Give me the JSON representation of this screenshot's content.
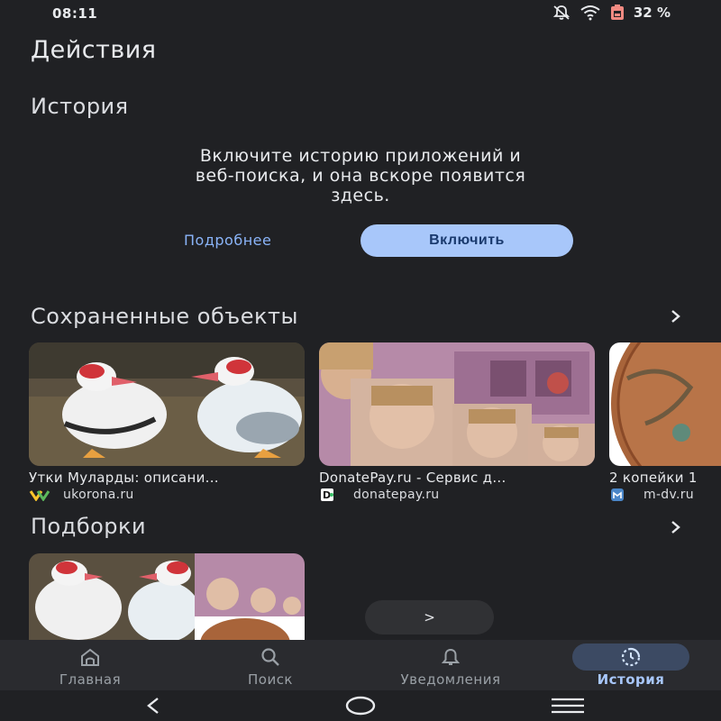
{
  "status": {
    "time": "08:11",
    "battery": "32 %"
  },
  "page_title": "Действия",
  "history": {
    "title": "История",
    "message_lines": [
      "Включите историю приложений и",
      "веб-поиска, и она вскоре появится",
      "здесь."
    ],
    "more_label": "Подробнее",
    "enable_label": "Включить"
  },
  "saved": {
    "title": "Сохраненные объекты",
    "items": [
      {
        "title": "Утки Муларды: описани...",
        "source": "ukorona.ru"
      },
      {
        "title": "DonatePay.ru - Сервис д...",
        "source": "donatepay.ru"
      },
      {
        "title": "2 копейки 1",
        "source": "m-dv.ru"
      }
    ]
  },
  "collections": {
    "title": "Подборки"
  },
  "scroll_button": ">",
  "nav": {
    "items": [
      {
        "label": "Главная",
        "icon": "home-icon"
      },
      {
        "label": "Поиск",
        "icon": "search-icon"
      },
      {
        "label": "Уведомления",
        "icon": "bell-icon"
      },
      {
        "label": "История",
        "icon": "history-icon"
      }
    ],
    "active_index": 3
  },
  "colors": {
    "background": "#202124",
    "accent": "#a8c7fa",
    "link": "#8ab4f8"
  }
}
